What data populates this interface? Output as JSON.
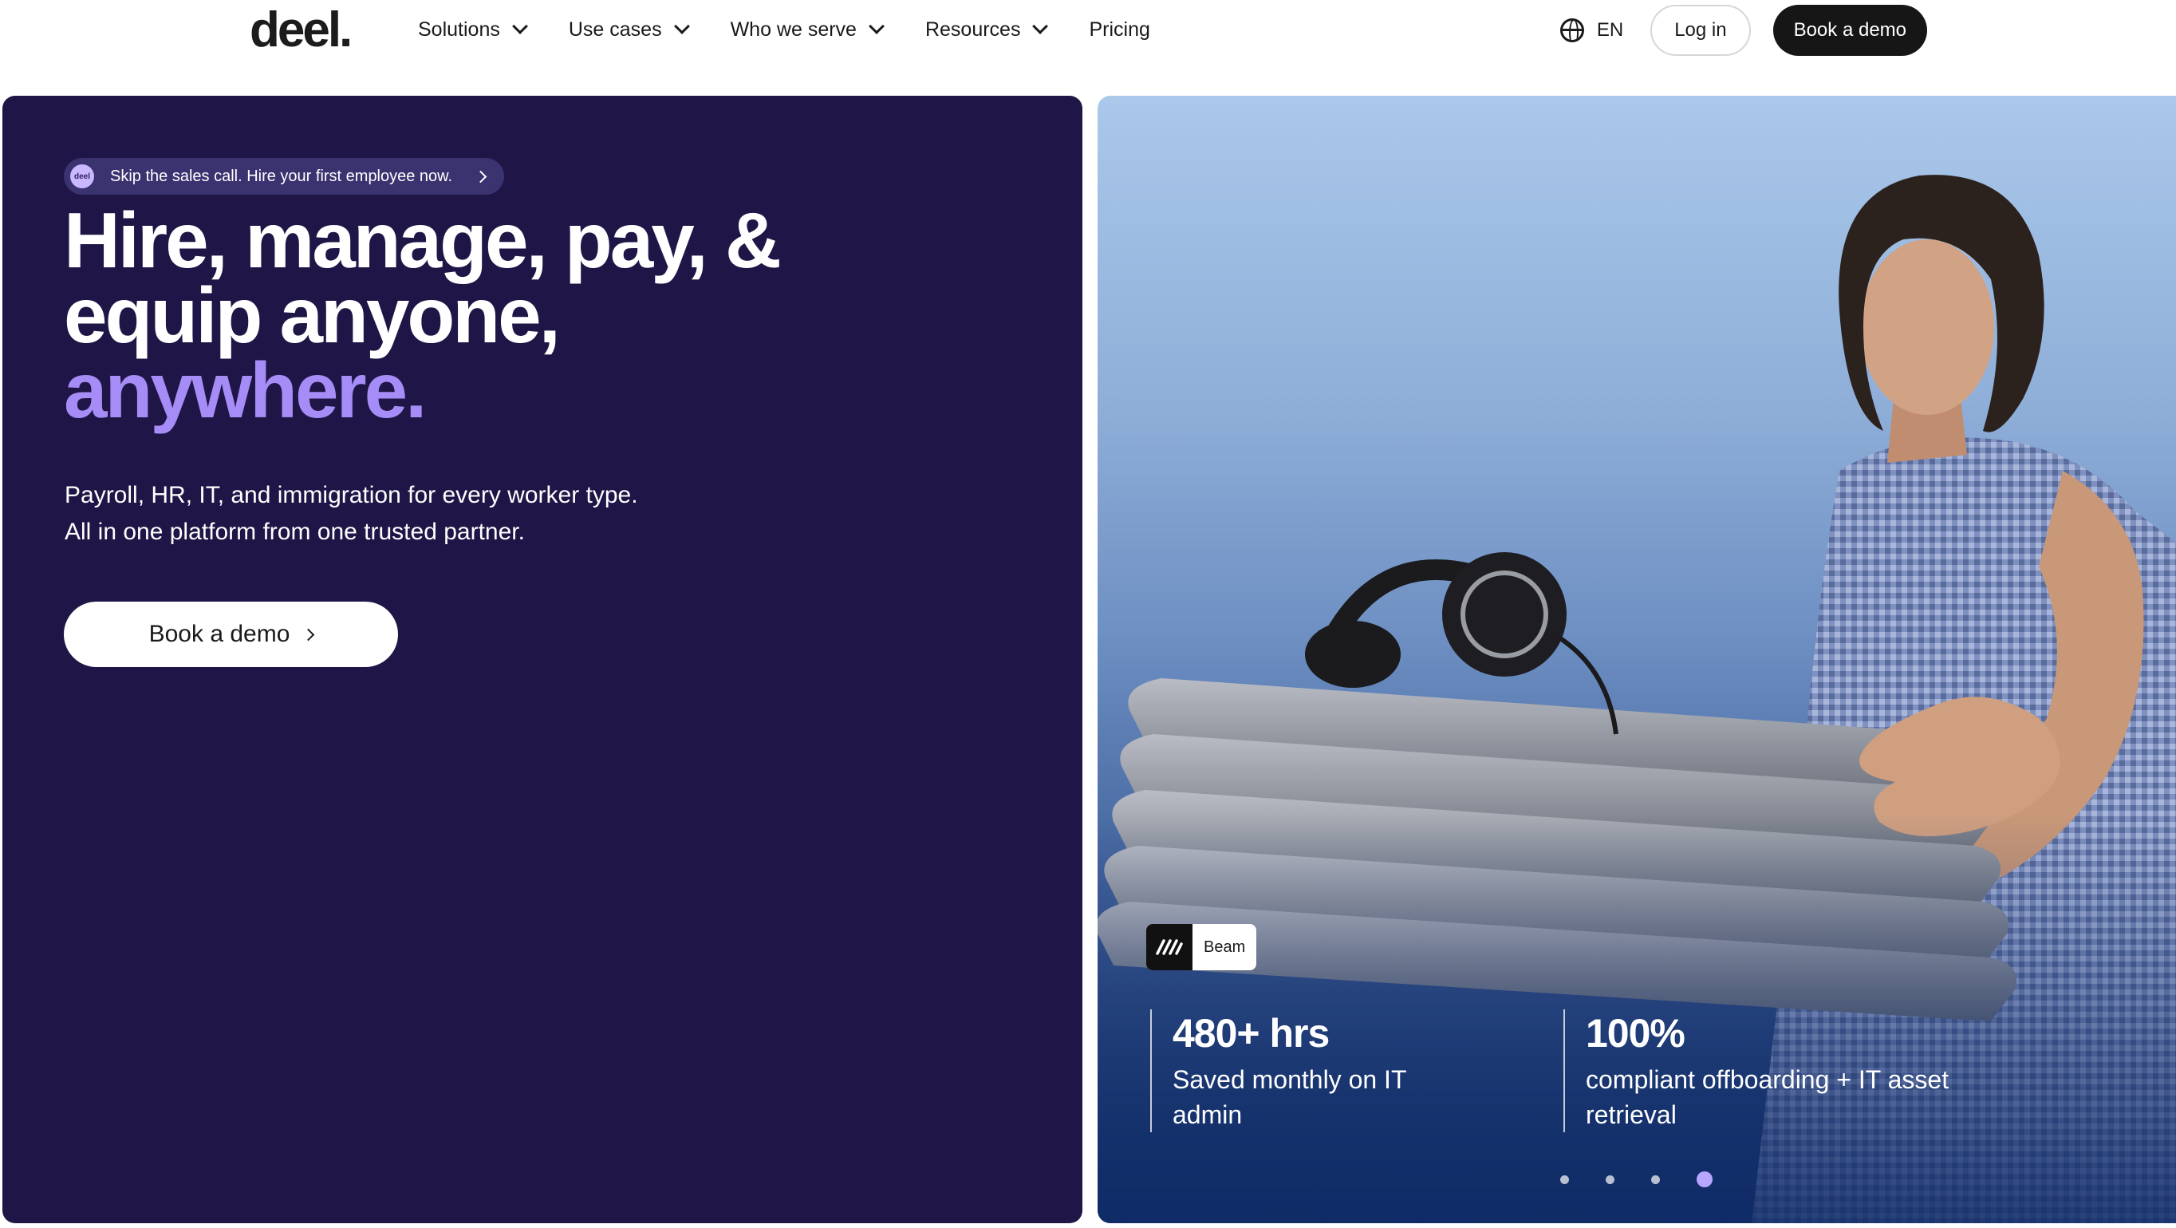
{
  "nav": {
    "logo": "deel.",
    "menu": [
      {
        "label": "Solutions"
      },
      {
        "label": "Use cases"
      },
      {
        "label": "Who we serve"
      },
      {
        "label": "Resources"
      },
      {
        "label": "Pricing"
      }
    ],
    "language": "EN",
    "login_label": "Log in",
    "book_demo_label": "Book a demo"
  },
  "hero": {
    "pill_logo": "deel",
    "pill_text": "Skip the sales call. Hire your first employee now.",
    "headline_line1": "Hire, manage, pay, &",
    "headline_line2": "equip anyone,",
    "headline_accent": "anywhere.",
    "sub_line1": "Payroll, HR, IT, and immigration for every worker type.",
    "sub_line2": "All in one platform from one trusted partner.",
    "cta_label": "Book a demo"
  },
  "testimonial": {
    "company": "Beam",
    "stats": [
      {
        "value": "480+ hrs",
        "desc_line1": "Saved monthly on IT",
        "desc_line2": "admin"
      },
      {
        "value": "100%",
        "desc_line1": "compliant offboarding + IT asset",
        "desc_line2": "retrieval"
      }
    ],
    "slides_total": 4,
    "slide_active": 4
  },
  "colors": {
    "hero_bg": "#1f1546",
    "accent": "#a58cf6",
    "dark_button": "#161616"
  }
}
